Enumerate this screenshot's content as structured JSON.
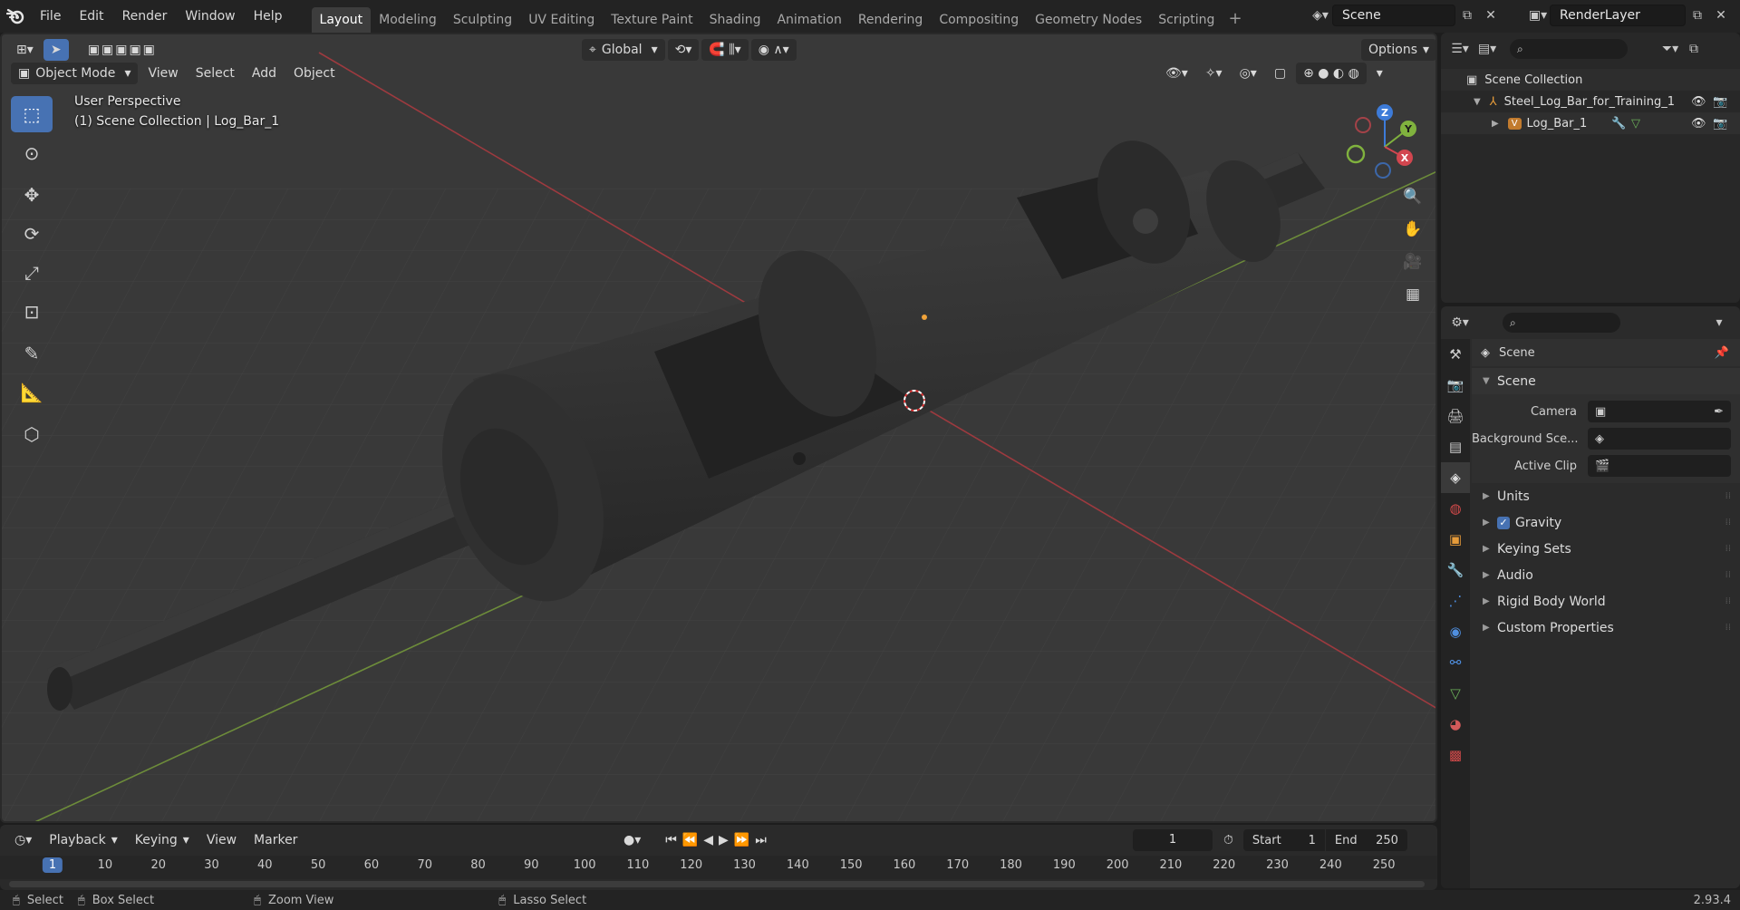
{
  "topbar": {
    "menus": [
      "File",
      "Edit",
      "Render",
      "Window",
      "Help"
    ],
    "workspaces": [
      "Layout",
      "Modeling",
      "Sculpting",
      "UV Editing",
      "Texture Paint",
      "Shading",
      "Animation",
      "Rendering",
      "Compositing",
      "Geometry Nodes",
      "Scripting"
    ],
    "active_workspace": "Layout",
    "scene_name": "Scene",
    "view_layer": "RenderLayer"
  },
  "viewport": {
    "mode": "Object Mode",
    "menus": [
      "View",
      "Select",
      "Add",
      "Object"
    ],
    "transform_orientation": "Global",
    "options_label": "Options",
    "overlay_line1": "User Perspective",
    "overlay_line2": "(1) Scene Collection | Log_Bar_1",
    "gizmo_axes": {
      "z": "Z",
      "y": "Y",
      "x": "X"
    }
  },
  "outliner": {
    "root": "Scene Collection",
    "items": [
      {
        "label": "Steel_Log_Bar_for_Training_1"
      },
      {
        "label": "Log_Bar_1"
      }
    ]
  },
  "properties": {
    "context_title": "Scene",
    "panel_title": "Scene",
    "fields": [
      {
        "label": "Camera",
        "value": ""
      },
      {
        "label": "Background Sce...",
        "value": ""
      },
      {
        "label": "Active Clip",
        "value": ""
      }
    ],
    "subpanels": [
      {
        "label": "Units",
        "checkbox": false
      },
      {
        "label": "Gravity",
        "checkbox": true,
        "checked": true
      },
      {
        "label": "Keying Sets",
        "checkbox": false
      },
      {
        "label": "Audio",
        "checkbox": false
      },
      {
        "label": "Rigid Body World",
        "checkbox": false
      },
      {
        "label": "Custom Properties",
        "checkbox": false
      }
    ]
  },
  "timeline": {
    "menus": [
      "Playback",
      "Keying",
      "View",
      "Marker"
    ],
    "current_frame": "1",
    "start_label": "Start",
    "start_value": "1",
    "end_label": "End",
    "end_value": "250",
    "ruler_ticks": [
      "10",
      "20",
      "30",
      "40",
      "50",
      "60",
      "70",
      "80",
      "90",
      "100",
      "110",
      "120",
      "130",
      "140",
      "150",
      "160",
      "170",
      "180",
      "190",
      "200",
      "210",
      "220",
      "230",
      "240",
      "250"
    ]
  },
  "statusbar": {
    "select": "Select",
    "box_select": "Box Select",
    "zoom_view": "Zoom View",
    "lasso_select": "Lasso Select",
    "version": "2.93.4"
  },
  "colors": {
    "accent": "#4772b3",
    "x_axis": "#d2464f",
    "y_axis": "#80b23e",
    "z_axis": "#3d7bd8",
    "viewport_bg": "#393939"
  }
}
